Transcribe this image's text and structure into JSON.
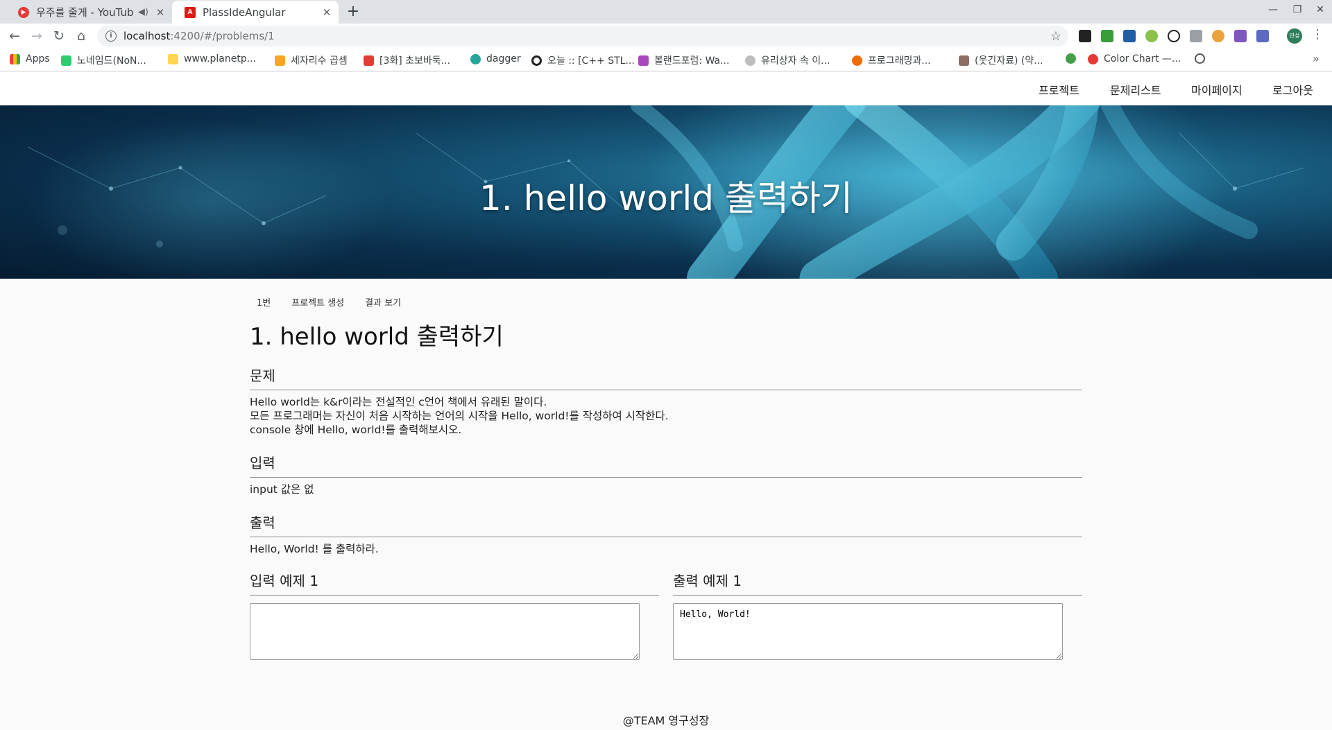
{
  "browser": {
    "tabs": [
      {
        "title": "우주를 줄게 - YouTube M",
        "active": false
      },
      {
        "title": "PlassIdeAngular",
        "active": true
      }
    ],
    "url_host": "localhost",
    "url_path": ":4200/#/problems/1",
    "bookmarks": [
      "Apps",
      "노네임드(NoN...",
      "www.planetp...",
      "세자리수 곱셈",
      "[3화] 초보바둑...",
      "dagger",
      "오늘 :: [C++ STL...",
      "볼랜드포럼: Wa...",
      "유리상자 속 이...",
      "프로그래밍과...",
      "(웃긴자료) (약...",
      "Color Chart —..."
    ],
    "profile_label": "민성"
  },
  "nav": {
    "items": [
      "프로젝트",
      "문제리스트",
      "마이페이지",
      "로그아웃"
    ]
  },
  "hero": {
    "title": "1. hello world 출력하기"
  },
  "problem": {
    "crumbs": [
      "1번",
      "프로젝트 생성",
      "결과 보기"
    ],
    "title": "1. hello world 출력하기",
    "sections": {
      "problem_h": "문제",
      "problem_lines": [
        "Hello world는 k&r이라는 전설적인 c언어 책에서 유래된 말이다.",
        "모든 프로그래머는 자신이 처음 시작하는 언어의 시작을 Hello, world!를 작성하여 시작한다.",
        "console 창에 Hello, world!를 출력해보시오."
      ],
      "input_h": "입력",
      "input_text": "input 값은 없",
      "output_h": "출력",
      "output_text": "Hello, World! 를 출력하라."
    },
    "example_input_h": "입력 예제 1",
    "example_output_h": "출력 예제 1",
    "example_input_value": "",
    "example_output_value": "Hello, World!"
  },
  "footer": "@TEAM 영구성장"
}
